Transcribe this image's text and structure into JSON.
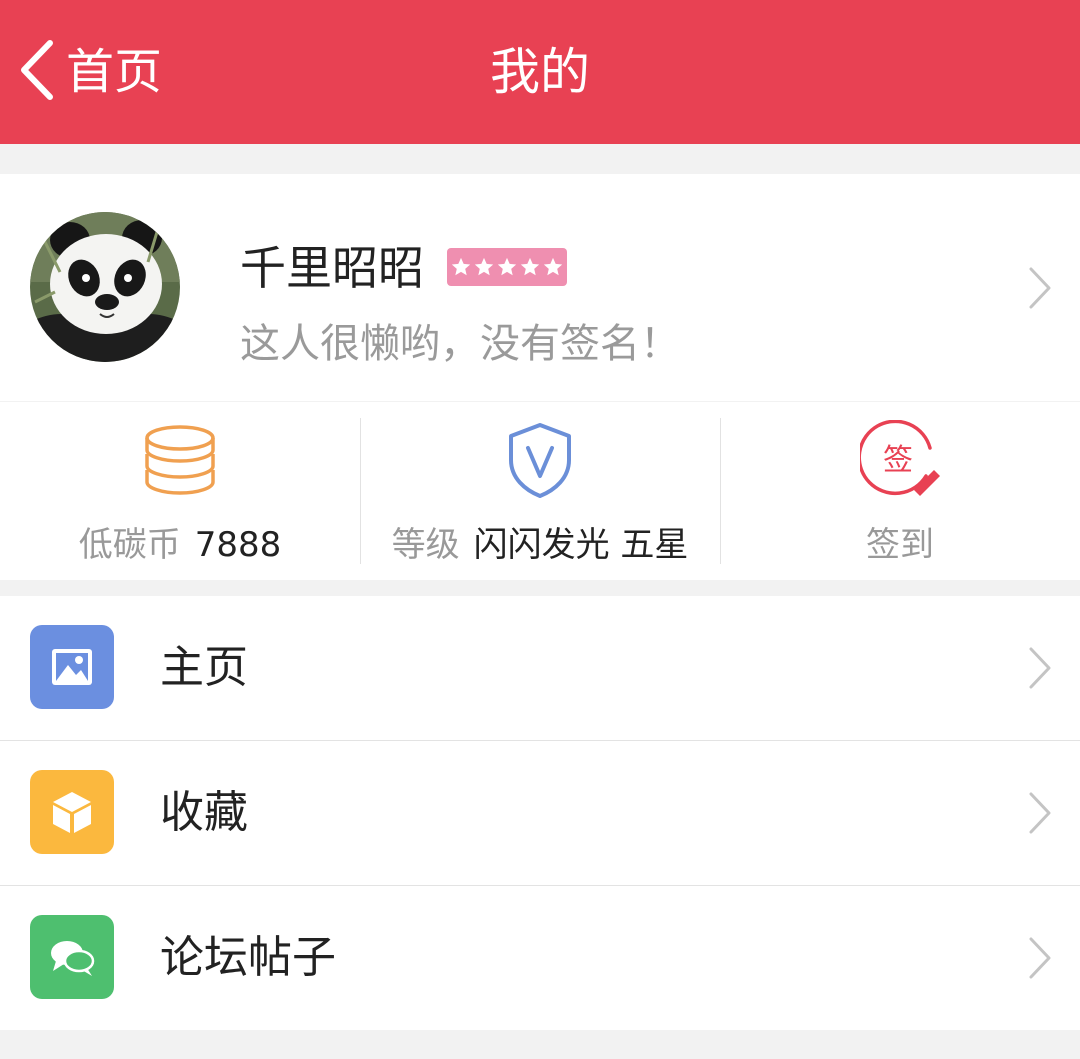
{
  "colors": {
    "brand": "#e84153",
    "coin_icon": "#f0a050",
    "level_icon": "#6b8fd8",
    "signin_icon": "#e84153",
    "stars_badge": "#ef8fb0",
    "home_icon_bg": "#6b8fe0",
    "favorites_icon_bg": "#fbb83e",
    "forum_icon_bg": "#4ebf6f"
  },
  "header": {
    "back_label": "首页",
    "title": "我的"
  },
  "profile": {
    "avatar_icon": "panda-avatar",
    "username": "千里昭昭",
    "rating_stars": 5,
    "signature": "这人很懒哟，没有签名！"
  },
  "stats": {
    "coins": {
      "icon": "coin-stack-icon",
      "label": "低碳币",
      "value": "7888"
    },
    "level": {
      "icon": "shield-v-icon",
      "label": "等级",
      "value": "闪闪发光 五星"
    },
    "signin": {
      "icon": "sign-in-icon",
      "icon_char": "签",
      "label": "签到"
    }
  },
  "menu": [
    {
      "icon": "image-icon",
      "label": "主页"
    },
    {
      "icon": "box-icon",
      "label": "收藏"
    },
    {
      "icon": "chat-bubbles-icon",
      "label": "论坛帖子"
    }
  ]
}
